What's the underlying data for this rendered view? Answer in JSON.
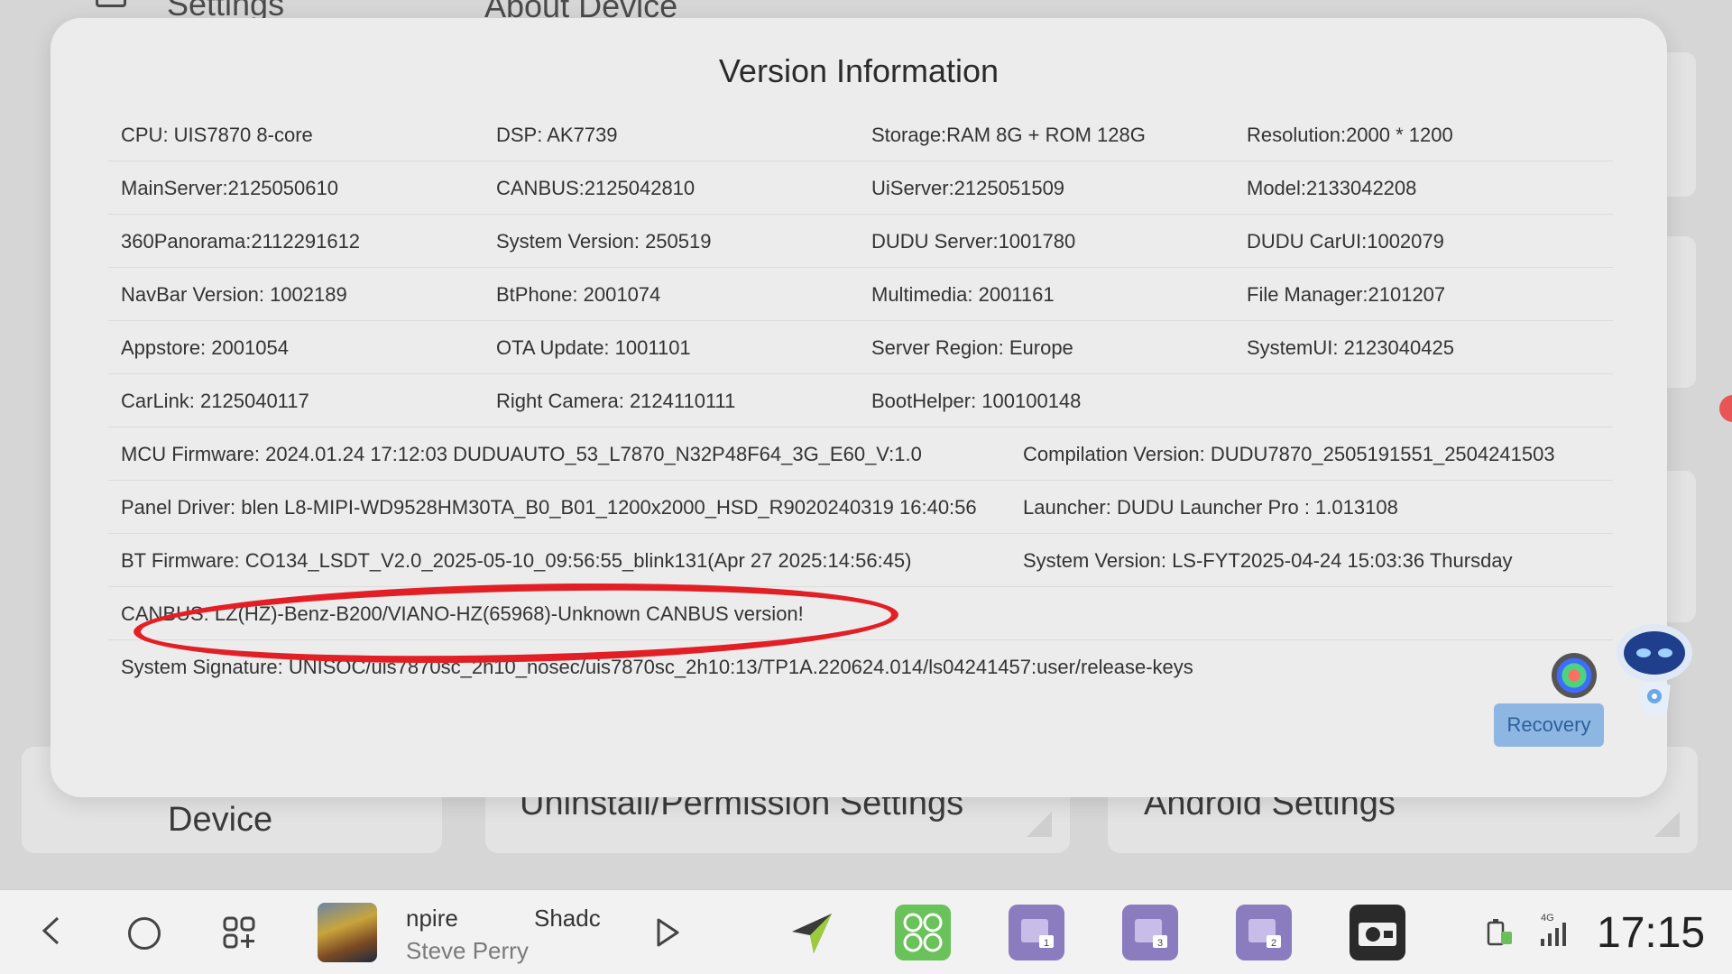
{
  "background": {
    "header_title": "Settings",
    "header_subtitle": "About Device",
    "cards": [
      "Device",
      "Uninstall/Permission Settings",
      "Android Settings"
    ]
  },
  "dialog": {
    "title": "Version Information",
    "rows": [
      [
        "CPU:  UIS7870 8-core",
        "DSP:  AK7739",
        "Storage:RAM 8G + ROM 128G",
        "Resolution:2000 * 1200"
      ],
      [
        "MainServer:2125050610",
        "CANBUS:2125042810",
        "UiServer:2125051509",
        "Model:2133042208"
      ],
      [
        "360Panorama:2112291612",
        "System Version:  250519",
        "DUDU Server:1001780",
        "DUDU CarUI:1002079"
      ],
      [
        "NavBar Version:  1002189",
        "BtPhone:   2001074",
        "Multimedia:   2001161",
        "File Manager:2101207"
      ],
      [
        "Appstore:   2001054",
        "OTA Update:   1001101",
        "Server Region:  Europe",
        "SystemUI:   2123040425"
      ],
      [
        "CarLink:   2125040117",
        "Right Camera:   2124110111",
        "BootHelper: 100100148",
        ""
      ]
    ],
    "wide_rows": [
      [
        "MCU Firmware:  2024.01.24 17:12:03 DUDUAUTO_53_L7870_N32P48F64_3G_E60_V:1.0",
        "Compilation Version:  DUDU7870_2505191551_2504241503"
      ],
      [
        "Panel Driver:  blen L8-MIPI-WD9528HM30TA_B0_B01_1200x2000_HSD_R9020240319 16:40:56",
        "Launcher:  DUDU Launcher Pro : 1.013108"
      ],
      [
        "BT Firmware:  CO134_LSDT_V2.0_2025-05-10_09:56:55_blink131(Apr 27 2025:14:56:45)",
        "System Version:  LS-FYT2025-04-24 15:03:36 Thursday"
      ]
    ],
    "canbus_line": "CANBUS:  LZ(HZ)-Benz-B200/VIANO-HZ(65968)-Unknown CANBUS version!",
    "signature_line": "System Signature:  UNISOC/uis7870sc_2h10_nosec/uis7870sc_2h10:13/TP1A.220624.014/ls04241457:user/release-keys",
    "recovery_label": "Recovery"
  },
  "annotation_color": "#e31f26",
  "taskbar": {
    "song_title_a": "npire",
    "song_title_b": "Shadc",
    "artist": "Steve Perry",
    "network_label": "4G",
    "clock": "17:15"
  }
}
